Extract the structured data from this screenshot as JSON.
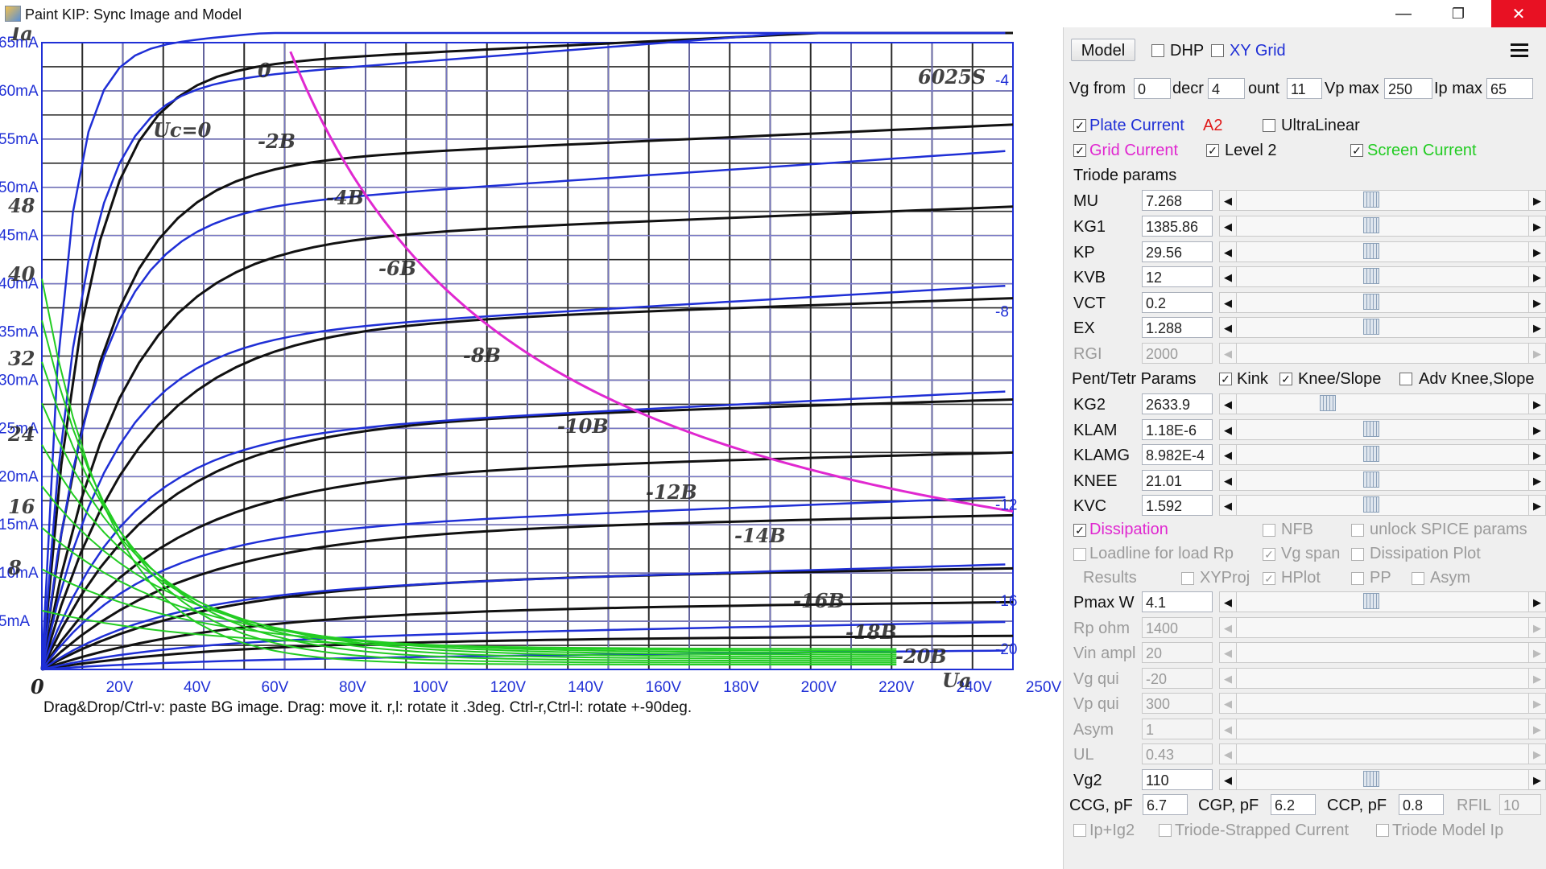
{
  "window": {
    "title": "Paint KIP: Sync Image and Model",
    "minimize": "—",
    "maximize": "❐",
    "close": "✕"
  },
  "plot": {
    "hint": "Drag&Drop/Ctrl-v: paste BG image. Drag: move it. r,l: rotate it .3deg. Ctrl-r,Ctrl-l: rotate +-90deg.",
    "x_ticks": [
      "20V",
      "40V",
      "60V",
      "80V",
      "100V",
      "120V",
      "140V",
      "160V",
      "180V",
      "200V",
      "220V",
      "240V",
      "250V"
    ],
    "y_ticks": [
      "65mA",
      "60mA",
      "55mA",
      "50mA",
      "45mA",
      "40mA",
      "35mA",
      "30mA",
      "25mA",
      "20mA",
      "15mA",
      "10mA",
      "5mA"
    ],
    "right_labels": [
      "-4",
      "-8",
      "-12",
      "-16",
      "-20"
    ],
    "bg_text": [
      "Ia",
      "Uc=0",
      "-2B",
      "-4B",
      "-6B",
      "-8B",
      "-10B",
      "-12B",
      "-14B",
      "-16B",
      "-18B",
      "-20B",
      "6025S",
      "32",
      "24",
      "16",
      "8",
      "40",
      "48",
      "0",
      "Ua"
    ]
  },
  "panel": {
    "model_button": "Model",
    "dhp": "DHP",
    "xy_grid": "XY Grid",
    "vg_from_label": "Vg from",
    "vg_from": "0",
    "decr_label": "decr",
    "decr": "4",
    "count_label": "ount",
    "count": "11",
    "vpmax_label": "Vp max",
    "vpmax": "250",
    "ipmax_label": "Ip max",
    "ipmax": "65",
    "plate_current": "Plate Current",
    "a2": "A2",
    "ultralinear": "UltraLinear",
    "grid_current": "Grid Current",
    "level2": "Level 2",
    "screen_current": "Screen Current",
    "triode_params": "Triode params",
    "mu_label": "MU",
    "mu": "7.268",
    "kg1_label": "KG1",
    "kg1": "1385.86",
    "kp_label": "KP",
    "kp": "29.56",
    "kvb_label": "KVB",
    "kvb": "12",
    "vct_label": "VCT",
    "vct": "0.2",
    "ex_label": "EX",
    "ex": "1.288",
    "rgi_label": "RGI",
    "rgi": "2000",
    "pent_params": "Pent/Tetr Params",
    "kink": "Kink",
    "knee_slope": "Knee/Slope",
    "adv_knee": "Adv Knee,Slope",
    "kg2_label": "KG2",
    "kg2": "2633.9",
    "klam_label": "KLAM",
    "klam": "1.18E-6",
    "klamg_label": "KLAMG",
    "klamg": "8.982E-4",
    "knee_label": "KNEE",
    "knee": "21.01",
    "kvc_label": "KVC",
    "kvc": "1.592",
    "dissipation": "Dissipation",
    "nfb": "NFB",
    "unlock_spice": "unlock SPICE params",
    "loadline": "Loadline for load Rp",
    "vg_span": "Vg span",
    "dissipation_plot": "Dissipation Plot",
    "results": "Results",
    "xyproj": "XYProj",
    "hplot": "HPlot",
    "pp": "PP",
    "asym_cb": "Asym",
    "pmax_label": "Pmax W",
    "pmax": "4.1",
    "rp_label": "Rp ohm",
    "rp": "1400",
    "vin_label": "Vin ampl",
    "vin": "20",
    "vgqui_label": "Vg qui",
    "vgqui": "-20",
    "vpqui_label": "Vp qui",
    "vpqui": "300",
    "asym_label": "Asym",
    "asym": "1",
    "ul_label": "UL",
    "ul": "0.43",
    "vg2_label": "Vg2",
    "vg2": "110",
    "ccg_label": "CCG, pF",
    "ccg": "6.7",
    "cgp_label": "CGP, pF",
    "cgp": "6.2",
    "ccp_label": "CCP, pF",
    "ccp": "0.8",
    "rfil_label": "RFIL",
    "rfil": "10",
    "ip_ig2": "Ip+Ig2",
    "triode_strapped": "Triode-Strapped Current",
    "triode_model": "Triode Model Ip",
    "check_mark": "✓",
    "arrow_left": "◀",
    "arrow_right": "▶"
  },
  "colors": {
    "model": "#1f2fd6",
    "grid_current": "#e028d0",
    "screen": "#22cc22",
    "a2": "#e01818",
    "hint": "#1a8a3a",
    "close": "#e81123"
  }
}
